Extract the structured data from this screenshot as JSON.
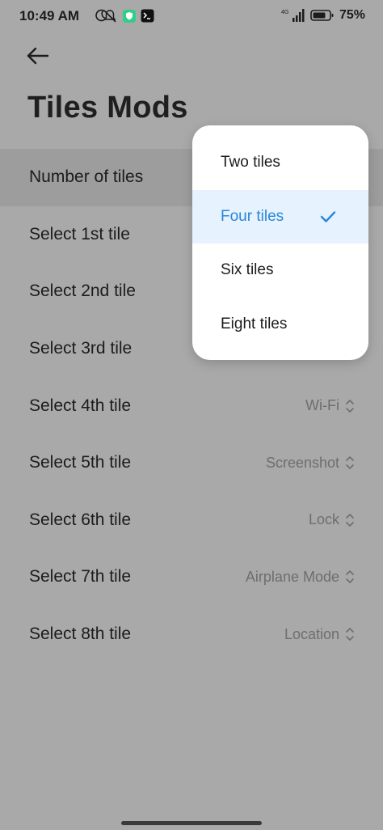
{
  "status_bar": {
    "time": "10:49 AM",
    "network": "4G",
    "battery": "75%",
    "icons": [
      "moon-icon",
      "notifications-off-icon",
      "shield-app-icon",
      "terminal-app-icon",
      "signal-icon",
      "battery-icon"
    ]
  },
  "header": {
    "title": "Tiles Mods"
  },
  "settings": [
    {
      "label": "Number of tiles",
      "value": ""
    },
    {
      "label": "Select 1st tile",
      "value": ""
    },
    {
      "label": "Select 2nd tile",
      "value": ""
    },
    {
      "label": "Select 3rd tile",
      "value": ""
    },
    {
      "label": "Select 4th tile",
      "value": "Wi-Fi"
    },
    {
      "label": "Select 5th tile",
      "value": "Screenshot"
    },
    {
      "label": "Select 6th tile",
      "value": "Lock"
    },
    {
      "label": "Select 7th tile",
      "value": "Airplane Mode"
    },
    {
      "label": "Select 8th tile",
      "value": "Location"
    }
  ],
  "dropdown": {
    "options": [
      "Two tiles",
      "Four tiles",
      "Six tiles",
      "Eight tiles"
    ],
    "selected": "Four tiles"
  },
  "colors": {
    "accent": "#2a87d9",
    "selected_bg": "#e6f2fd",
    "dim_background": "#a9a9a9"
  }
}
